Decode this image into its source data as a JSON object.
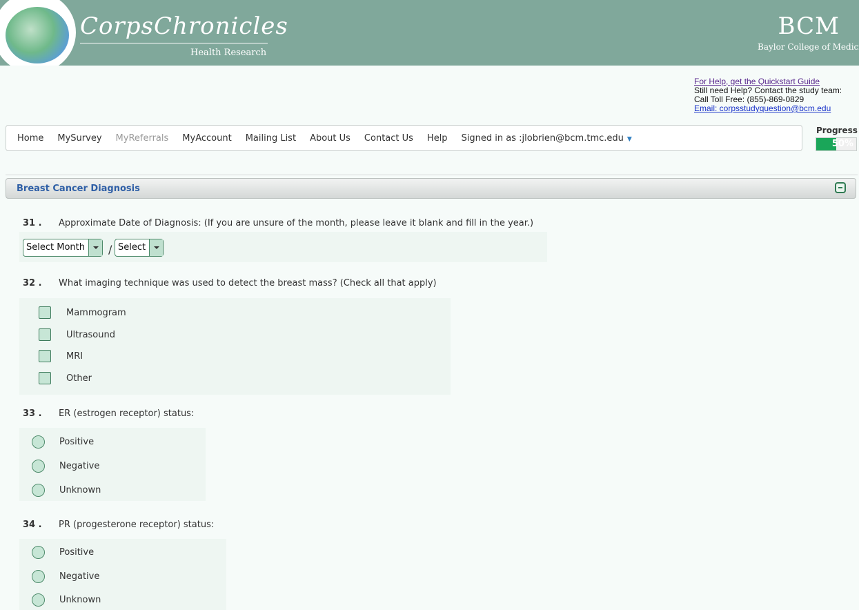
{
  "header": {
    "brand": "CorpsChronicles",
    "brand_sub": "Health Research",
    "org_short": "BCM",
    "org_name": "Baylor College of Medicine"
  },
  "help": {
    "quickstart_link": "For Help, get the Quickstart Guide",
    "still_need": "Still need Help? Contact the study team:",
    "phone": "Call Toll Free: (855)-869-0829",
    "email_link": "Email: corpsstudyquestion@bcm.edu"
  },
  "nav": {
    "items": [
      "Home",
      "MySurvey",
      "MyReferrals",
      "MyAccount",
      "Mailing List",
      "About Us",
      "Contact Us",
      "Help"
    ],
    "signed_in": "Signed in as :jlobrien@bcm.tmc.edu"
  },
  "progress": {
    "label": "Progress",
    "value_text": "50%",
    "value": 0.5,
    "color": "#1aa659"
  },
  "section": {
    "title": "Breast Cancer Diagnosis"
  },
  "questions": {
    "q31": {
      "number": "31 .",
      "text": "Approximate Date of Diagnosis: (If you are unsure of the month, please leave it blank and fill in the year.)",
      "month_select": "Select Month",
      "year_select": "Select"
    },
    "q32": {
      "number": "32 .",
      "text": "What imaging technique was used to detect the breast mass? (Check all that apply)",
      "options": [
        "Mammogram",
        "Ultrasound",
        "MRI",
        "Other"
      ]
    },
    "q33": {
      "number": "33 .",
      "text": "ER (estrogen receptor) status:",
      "options": [
        "Positive",
        "Negative",
        "Unknown"
      ]
    },
    "q34": {
      "number": "34 .",
      "text": "PR (progesterone receptor) status:",
      "options": [
        "Positive",
        "Negative",
        "Unknown"
      ]
    }
  }
}
